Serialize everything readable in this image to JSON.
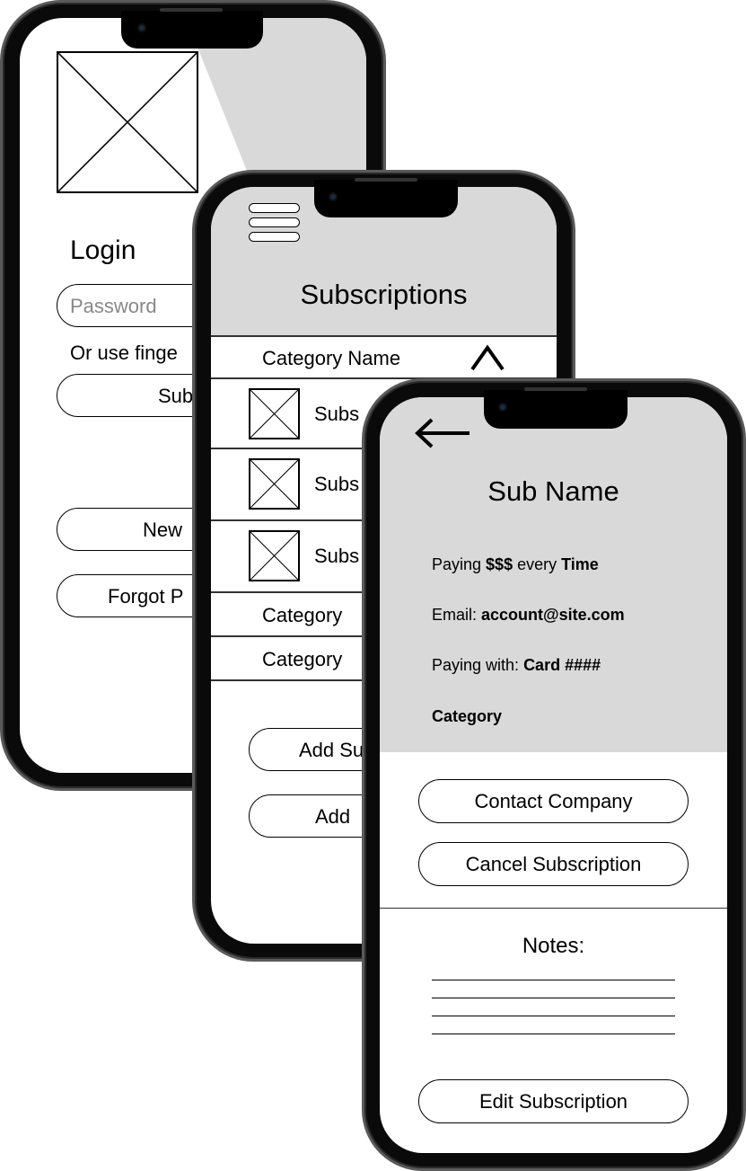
{
  "colors": {
    "header_gray": "#d9d9d9",
    "frame": "#0a0a0a"
  },
  "login_screen": {
    "image_placeholder": "image-placeholder-icon",
    "title": "Login",
    "password_placeholder": "Password",
    "fingerprint_text": "Or use finge",
    "submit_label": "Sub",
    "new_label": "New",
    "forgot_label": "Forgot P"
  },
  "subscriptions_screen": {
    "menu_icon": "hamburger-menu-icon",
    "title": "Subscriptions",
    "category_header": "Category Name",
    "chevron_icon": "chevron-up-icon",
    "items": [
      {
        "label": "Subs"
      },
      {
        "label": "Subs"
      },
      {
        "label": "Subs"
      }
    ],
    "categories": [
      {
        "label": "Category"
      },
      {
        "label": "Category"
      }
    ],
    "add_sub_label": "Add Su",
    "add_label": "Add"
  },
  "detail_screen": {
    "back_icon": "arrow-left-icon",
    "title": "Sub Name",
    "paying_prefix": "Paying ",
    "paying_amount": "$$$",
    "paying_mid": " every ",
    "paying_period": "Time",
    "email_label": "Email: ",
    "email_value": "account@site.com",
    "method_label": "Paying with: ",
    "method_value": "Card ####",
    "category": "Category",
    "contact_label": "Contact Company",
    "cancel_label": "Cancel Subscription",
    "notes_label": "Notes:",
    "edit_label": "Edit Subscription"
  }
}
